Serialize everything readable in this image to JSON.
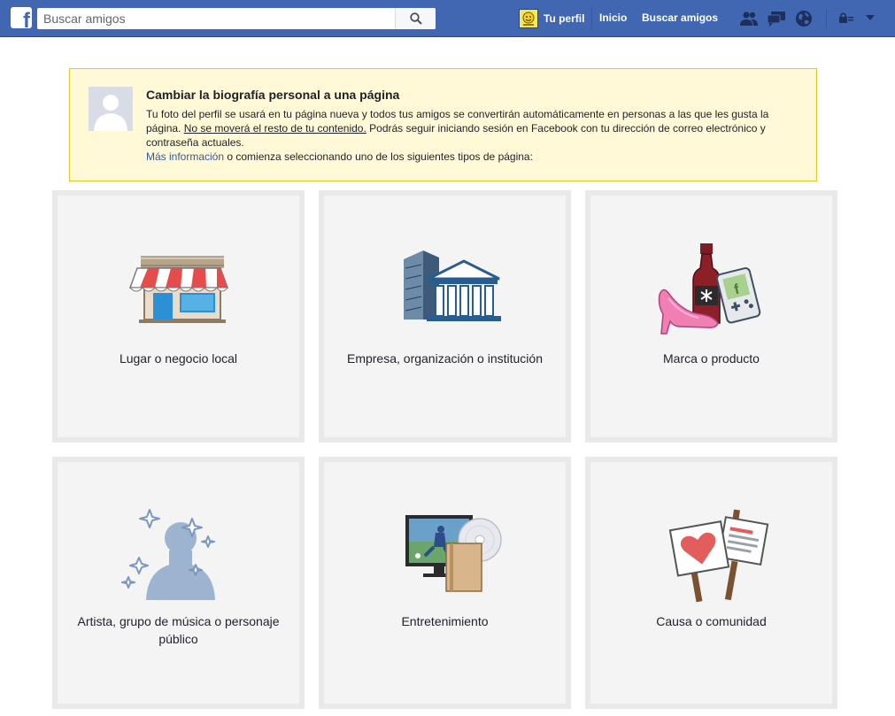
{
  "topbar": {
    "search": {
      "placeholder": "Buscar amigos"
    },
    "profile_label": "Tu perfil",
    "home_label": "Inicio",
    "find_friends_label": "Buscar amigos",
    "icons": [
      "friends-icon",
      "messages-icon",
      "notifications-globe-icon",
      "privacy-lock-icon",
      "chevron-down-icon"
    ]
  },
  "notice": {
    "title": "Cambiar la biografía personal a una página",
    "line1": "Tu foto del perfil se usará en tu página nueva y todos tus amigos se convertirán automáticamente en personas a las que les gusta la página. ",
    "underlined": "No se moverá el resto de tu contenido.",
    "line2": " Podrás seguir iniciando sesión en Facebook con tu dirección de correo electrónico y contraseña actuales.",
    "link": "Más información",
    "tail": " o comienza seleccionando uno de los siguientes tipos de página:"
  },
  "categories": [
    {
      "label": "Lugar o negocio local",
      "icon": "storefront-icon"
    },
    {
      "label": "Empresa, organización o institución",
      "icon": "company-building-icon"
    },
    {
      "label": "Marca o producto",
      "icon": "brand-product-icon"
    },
    {
      "label": "Artista, grupo de música o personaje público",
      "icon": "artist-silhouette-icon"
    },
    {
      "label": "Entretenimiento",
      "icon": "entertainment-icon"
    },
    {
      "label": "Causa o comunidad",
      "icon": "cause-signs-icon"
    }
  ],
  "colors": {
    "topbar": "#4267b2",
    "notice_bg": "#fff9d7",
    "notice_border": "#e2c822",
    "link": "#365899",
    "tile_bg": "#f4f4f4",
    "tile_border": "#e8e9eb"
  }
}
